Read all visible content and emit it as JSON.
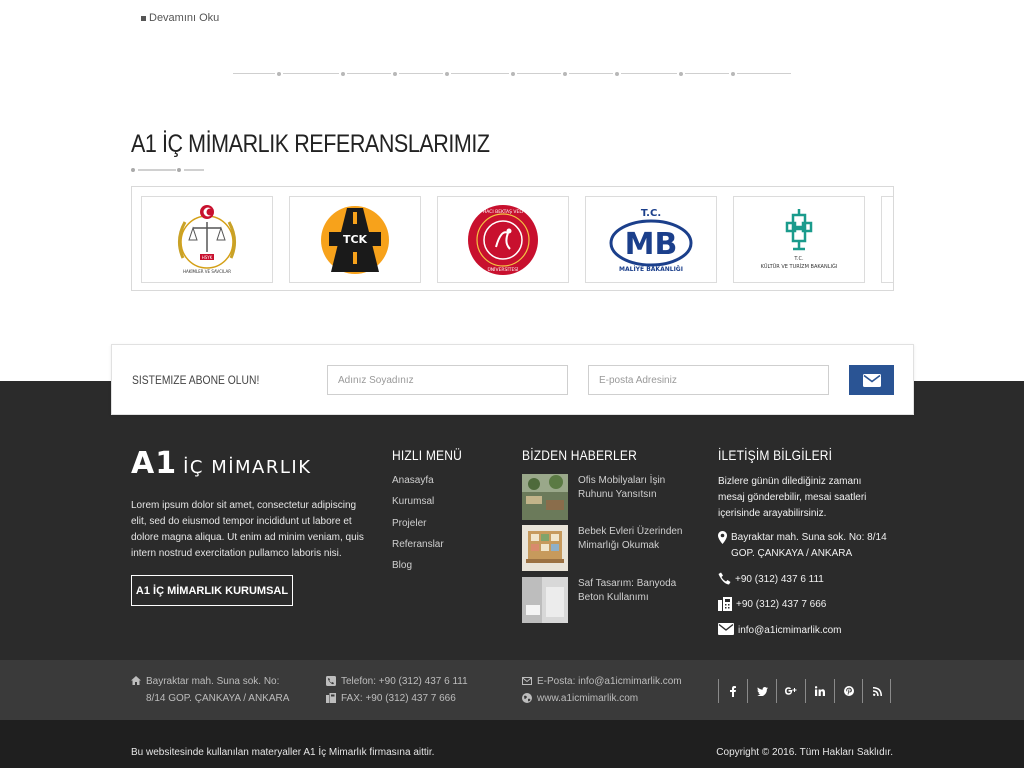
{
  "top": {
    "read_more": "Devamını Oku"
  },
  "references": {
    "title": "A1 İÇ MİMARLIK REFERANSLARIMIZ",
    "logos": [
      {
        "name": "hsyk-logo",
        "caption": "HSYK"
      },
      {
        "name": "tck-logo",
        "caption": "TCK"
      },
      {
        "name": "nevsehir-university-logo",
        "caption": "NEVŞEHİR HACI BEKTAŞ VELİ ÜNİVERSİTESİ"
      },
      {
        "name": "maliye-bakanligi-logo",
        "caption": "MALİYE BAKANLIĞI",
        "top": "T.C.",
        "letters": "MB"
      },
      {
        "name": "kultur-turizm-logo",
        "caption": "KÜLTÜR VE TURİZM BAKANLIĞI",
        "top": "T.C."
      }
    ]
  },
  "subscribe": {
    "label": "SISTEMIZE ABONE OLUN!",
    "name_placeholder": "Adınız Soyadınız",
    "email_placeholder": "E-posta Adresiniz"
  },
  "footer": {
    "logo_big": "A1",
    "logo_small": "İÇ MİMARLIK",
    "about": "Lorem ipsum dolor sit amet, consectetur adipiscing elit, sed do eiusmod tempor incididunt ut labore et dolore magna aliqua. Ut enim ad minim veniam, quis intern nostrud exercitation pullamco laboris nisi.",
    "corp_button": "A1 İÇ MİMARLIK KURUMSAL",
    "quick_menu_title": "HIZLI MENÜ",
    "quick_menu": [
      "Anasayfa",
      "Kurumsal",
      "Projeler",
      "Referanslar",
      "Blog"
    ],
    "news_title": "BİZDEN HABERLER",
    "news": [
      {
        "title": "Ofis Mobilyaları İşin Ruhunu Yansıtsın"
      },
      {
        "title": "Bebek Evleri Üzerinden Mimarlığı Okumak"
      },
      {
        "title": "Saf Tasarım: Banyoda Beton Kullanımı"
      }
    ],
    "contact_title": "İLETİŞİM BİLGİLERİ",
    "contact_intro": "Bizlere günün dilediğiniz zamanı mesaj gönderebilir, mesai saatleri içerisinde arayabilirsiniz.",
    "address": "Bayraktar mah. Suna sok. No: 8/14 GOP. ÇANKAYA / ANKARA",
    "phone": "+90 (312) 437 6 111",
    "fax": "+90 (312) 437 7 666",
    "email": "info@a1icmimarlik.com"
  },
  "bottom_bar": {
    "address": "Bayraktar mah. Suna sok. No: 8/14 GOP. ÇANKAYA / ANKARA",
    "phone": "Telefon: +90 (312) 437 6 111",
    "fax": "FAX: +90 (312) 437 7 666",
    "email": "E-Posta: info@a1icmimarlik.com",
    "web": "www.a1icmimarlik.com",
    "social": [
      "facebook-icon",
      "twitter-icon",
      "google-plus-icon",
      "linkedin-icon",
      "pinterest-icon",
      "rss-icon"
    ]
  },
  "copyright": {
    "left": "Bu websitesinde kullanılan materyaller A1 İç Mimarlık firmasına aittir.",
    "right": "Copyright © 2016. Tüm Hakları Saklıdır."
  },
  "colors": {
    "accent": "#2a5494",
    "footer_bg": "#2b2b2b",
    "bottom_bar_bg": "#3a3a3a",
    "copyright_bg": "#1f1f1f"
  }
}
